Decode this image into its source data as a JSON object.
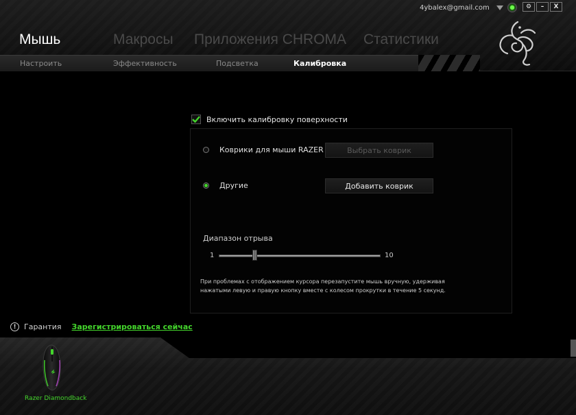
{
  "window": {
    "username": "4ybalex@gmail.com",
    "controls": {
      "settings": "⚙",
      "minimize": "–",
      "close": "X"
    }
  },
  "main_tabs": [
    {
      "label": "Мышь",
      "active": true
    },
    {
      "label": "Макросы",
      "active": false
    },
    {
      "label": "Приложения CHROMA",
      "active": false
    },
    {
      "label": "Статистики",
      "active": false
    }
  ],
  "sub_tabs": [
    {
      "label": "Настроить",
      "active": false
    },
    {
      "label": "Эффективность",
      "active": false
    },
    {
      "label": "Подсветка",
      "active": false
    },
    {
      "label": "Калибровка",
      "active": true
    }
  ],
  "calibration": {
    "enable_label": "Включить калибровку поверхности",
    "enable_checked": true,
    "options": [
      {
        "label": "Коврики для мыши RAZER",
        "selected": false,
        "button": "Выбрать коврик",
        "button_enabled": false
      },
      {
        "label": "Другие",
        "selected": true,
        "button": "Добавить коврик",
        "button_enabled": true
      }
    ],
    "liftoff": {
      "label": "Диапазон отрыва",
      "min": "1",
      "max": "10",
      "value": 2
    },
    "hint_line1": "При проблемах с отображением курсора перезапустите мышь вручную, удерживая",
    "hint_line2": "нажатыми левую и правую кнопку вместе с колесом прокрутки в течение 5 секунд."
  },
  "warranty": {
    "label": "Гарантия",
    "link": "Зарегистрироваться сейчас"
  },
  "device": {
    "name": "Razer Diamondback"
  },
  "colors": {
    "accent": "#44d62c",
    "background": "#000000"
  }
}
